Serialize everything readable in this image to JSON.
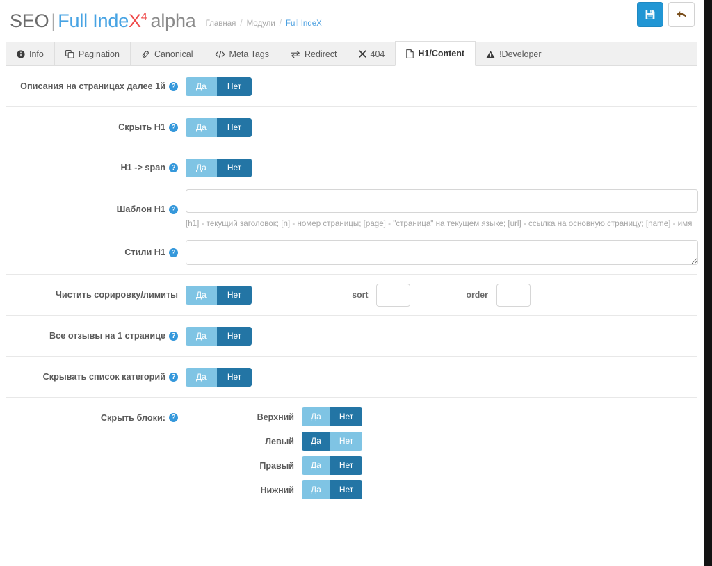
{
  "header": {
    "title": {
      "seo": "SEO",
      "pipe": "|",
      "full": "Full Inde",
      "x": "X",
      "sup": "4",
      "alpha": "alpha"
    },
    "breadcrumb": [
      {
        "label": "Главная",
        "active": false
      },
      {
        "label": "Модули",
        "active": false
      },
      {
        "label": "Full IndeX",
        "active": true
      }
    ],
    "separator": "/",
    "actions": {
      "save": {
        "name": "save-button",
        "icon": "floppy-disk-icon",
        "color": "#2196d4"
      },
      "back": {
        "name": "back-button",
        "icon": "undo-arrow-icon",
        "color": "#8a5a2b"
      }
    }
  },
  "tabs": [
    {
      "label": "Info",
      "icon": "info-circle-icon",
      "active": false
    },
    {
      "label": "Pagination",
      "icon": "copy-icon",
      "active": false
    },
    {
      "label": "Canonical",
      "icon": "link-icon",
      "active": false
    },
    {
      "label": "Meta Tags",
      "icon": "code-icon",
      "active": false
    },
    {
      "label": "Redirect",
      "icon": "exchange-icon",
      "active": false
    },
    {
      "label": "404",
      "icon": "times-icon",
      "active": false
    },
    {
      "label": "H1/Content",
      "icon": "file-icon",
      "active": true
    },
    {
      "label": "!Developer",
      "icon": "warning-icon",
      "active": false
    }
  ],
  "toggle_labels": {
    "yes": "Да",
    "no": "Нет"
  },
  "help_glyph": "?",
  "form": {
    "groups": [
      {
        "rows": [
          {
            "label": "Описания на страницах далее 1й",
            "has_help": true,
            "type": "toggle",
            "value": "no"
          }
        ]
      },
      {
        "rows": [
          {
            "label": "Скрыть H1",
            "has_help": true,
            "type": "toggle",
            "value": "no"
          },
          {
            "label": "H1 -> span",
            "has_help": true,
            "type": "toggle",
            "value": "no"
          },
          {
            "label": "Шаблон H1",
            "has_help": true,
            "type": "text",
            "value": "",
            "placeholder": "",
            "help_text": "[h1] - текущий заголовок; [n] - номер страницы; [page] - \"страница\" на текущем языке; [url] - ссылка на основную страницу; [name] - имя"
          },
          {
            "label": "Стили H1",
            "has_help": true,
            "type": "textarea",
            "value": "",
            "placeholder": ""
          }
        ]
      },
      {
        "rows": [
          {
            "label": "Чистить сорировку/лимиты",
            "has_help": false,
            "type": "toggle-with-inputs",
            "value": "no",
            "extra": [
              {
                "label": "sort",
                "value": "",
                "placeholder": ""
              },
              {
                "label": "order",
                "value": "",
                "placeholder": ""
              }
            ]
          }
        ]
      },
      {
        "rows": [
          {
            "label": "Все отзывы на 1 странице",
            "has_help": true,
            "type": "toggle",
            "value": "no"
          }
        ]
      },
      {
        "rows": [
          {
            "label": "Скрывать список категорий",
            "has_help": true,
            "type": "toggle",
            "value": "no"
          }
        ]
      }
    ],
    "blocks_section": {
      "label": "Скрыть блоки:",
      "has_help": true,
      "items": [
        {
          "name": "Верхний",
          "value": "no"
        },
        {
          "name": "Левый",
          "value": "yes"
        },
        {
          "name": "Правый",
          "value": "no"
        },
        {
          "name": "Нижний",
          "value": "no"
        }
      ]
    }
  }
}
